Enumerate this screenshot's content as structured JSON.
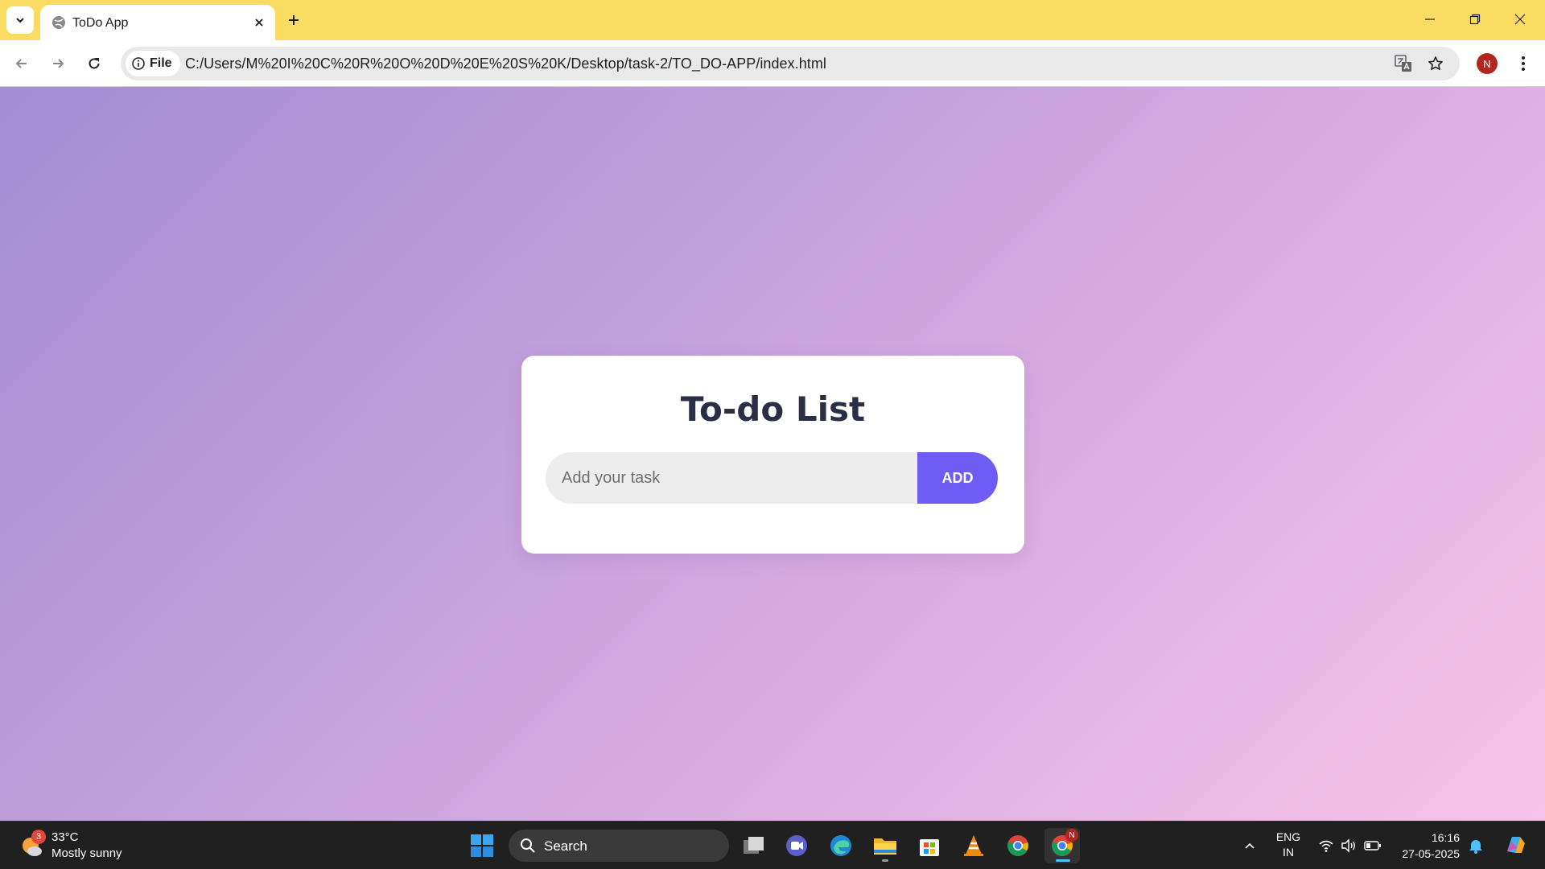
{
  "browser": {
    "tab_title": "ToDo App",
    "site_chip_label": "File",
    "url": "C:/Users/M%20I%20C%20R%20O%20D%20E%20S%20K/Desktop/task-2/TO_DO-APP/index.html",
    "profile_initial": "N",
    "accent_color": "#fbdc63"
  },
  "page": {
    "title": "To-do List",
    "task_input_placeholder": "Add your task",
    "task_input_value": "",
    "add_button_label": "ADD",
    "add_button_color": "#6f5cf4"
  },
  "taskbar": {
    "weather_badge": "3",
    "weather_temp": "33°C",
    "weather_desc": "Mostly sunny",
    "search_label": "Search",
    "lang_line1": "ENG",
    "lang_line2": "IN",
    "time": "16:16",
    "date": "27-05-2025",
    "chrome_badge": "N",
    "apps": [
      "start",
      "search",
      "task-view",
      "meet",
      "edge",
      "file-explorer",
      "microsoft-store",
      "vlc",
      "chrome",
      "chrome-profile"
    ]
  }
}
